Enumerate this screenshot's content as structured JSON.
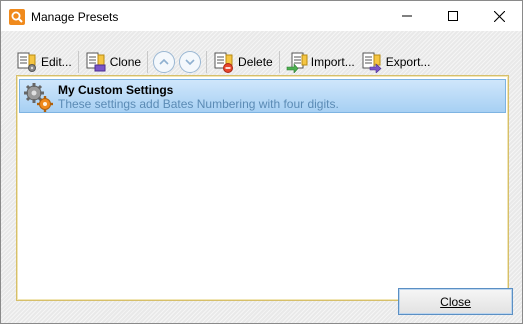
{
  "window": {
    "title": "Manage Presets"
  },
  "toolbar": {
    "edit_label": "Edit...",
    "clone_label": "Clone",
    "delete_label": "Delete",
    "import_label": "Import...",
    "export_label": "Export..."
  },
  "presets": [
    {
      "title": "My Custom Settings",
      "description": "These settings add Bates Numbering with four digits."
    }
  ],
  "footer": {
    "close_label": "Close"
  },
  "colors": {
    "selection": "#a7d0f3",
    "panel_border": "#d6bf6a",
    "accent_orange": "#f08a1c",
    "button_border": "#5a8fc4"
  }
}
